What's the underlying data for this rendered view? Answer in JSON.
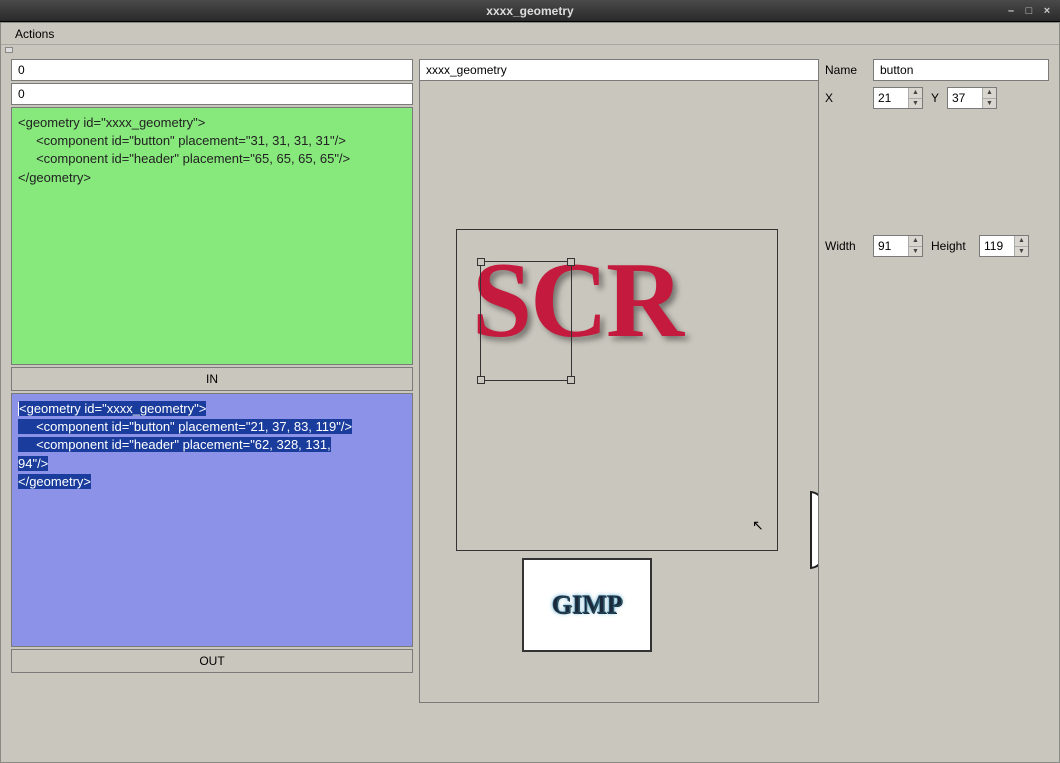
{
  "window": {
    "title": "xxxx_geometry"
  },
  "menubar": {
    "actions": "Actions"
  },
  "left": {
    "input1": "0",
    "input2": "0",
    "in_code": "<geometry id=\"xxxx_geometry\">\n     <component id=\"button\" placement=\"31, 31, 31, 31\"/>\n     <component id=\"header\" placement=\"65, 65, 65, 65\"/>\n</geometry>",
    "in_btn": "IN",
    "out_line1": "<geometry id=\"xxxx_geometry\">",
    "out_line2": "     <component id=\"button\" placement=\"21, 37, 83, 119\"/>",
    "out_line3a": "     <component id=\"header\" placement=\"62, 328, 131,",
    "out_line3b": "94\"/>",
    "out_line4": "</geometry>",
    "out_btn": "OUT"
  },
  "center": {
    "title": "xxxx_geometry",
    "scr": "SCR",
    "gimp": "GIMP"
  },
  "props": {
    "name_label": "Name",
    "name_value": "button",
    "x_label": "X",
    "x_value": "21",
    "y_label": "Y",
    "y_value": "37",
    "w_label": "Width",
    "w_value": "91",
    "h_label": "Height",
    "h_value": "119"
  }
}
